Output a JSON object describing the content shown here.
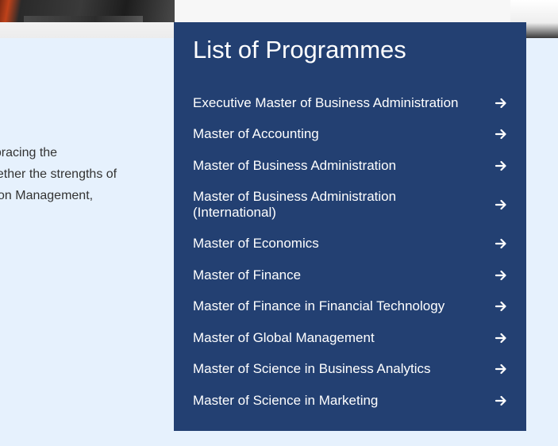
{
  "intro": {
    "lines": [
      "nbracing the",
      "gether the strengths of",
      "on Management,"
    ]
  },
  "panel": {
    "title": "List of Programmes",
    "items": [
      {
        "label": "Executive Master of Business Administration",
        "icon": "arrow-right-icon"
      },
      {
        "label": "Master of Accounting",
        "icon": "arrow-right-icon"
      },
      {
        "label": "Master of Business Administration",
        "icon": "arrow-right-icon"
      },
      {
        "label": "Master of Business Administration (International)",
        "icon": "arrow-right-icon"
      },
      {
        "label": "Master of Economics",
        "icon": "arrow-right-icon"
      },
      {
        "label": "Master of Finance",
        "icon": "arrow-right-icon"
      },
      {
        "label": "Master of Finance in Financial Technology",
        "icon": "arrow-right-icon"
      },
      {
        "label": "Master of Global Management",
        "icon": "arrow-right-icon"
      },
      {
        "label": "Master of Science in Business Analytics",
        "icon": "arrow-right-icon"
      },
      {
        "label": "Master of Science in Marketing",
        "icon": "arrow-right-icon"
      }
    ]
  },
  "colors": {
    "panel_bg": "#234072",
    "page_bg": "#e6f1fd",
    "text_on_panel": "#ffffff",
    "body_text": "#333333"
  }
}
